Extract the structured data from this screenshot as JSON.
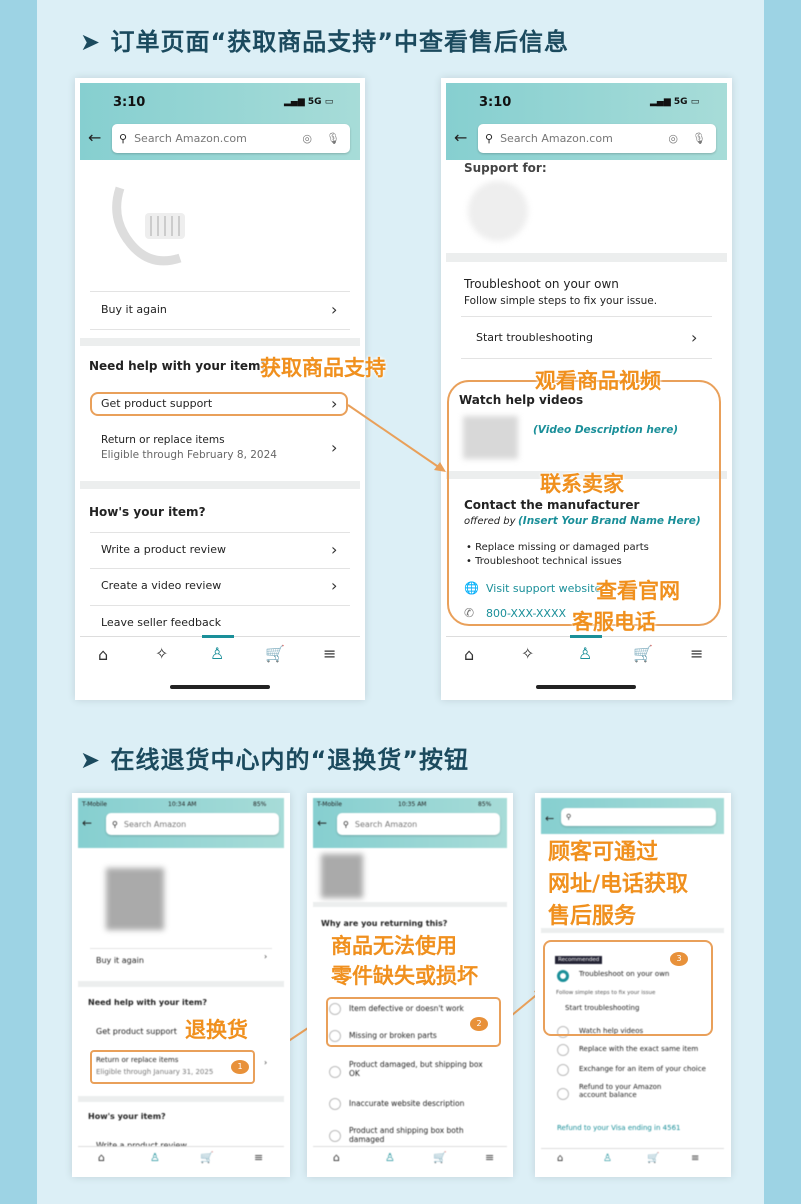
{
  "section1": {
    "title": "➤ 订单页面“获取商品支持”中查看售后信息"
  },
  "section2": {
    "title": "➤ 在线退货中心内的“退换货”按钮"
  },
  "phone_common": {
    "time": "3:10",
    "signal": "5G",
    "search_placeholder": "Search Amazon.com",
    "search_placeholder_short": "Search Amazon"
  },
  "phone1": {
    "buy_again": "Buy it again",
    "need_help": "Need help with your item?",
    "get_support": "Get product support",
    "return_replace": "Return or replace items",
    "eligible": "Eligible through February 8, 2024",
    "hows_item": "How's your item?",
    "write_review": "Write a product review",
    "create_video": "Create a video review",
    "seller_feedback": "Leave seller feedback"
  },
  "phone2": {
    "support_for": "Support for:",
    "troubleshoot_title": "Troubleshoot on your own",
    "troubleshoot_sub": "Follow simple steps to fix your issue.",
    "start_troubleshooting": "Start troubleshooting",
    "watch_videos": "Watch help videos",
    "video_desc": "(Video Description here)",
    "contact_title": "Contact the manufacturer",
    "offered_by": "offered by",
    "brand": "(Insert Your Brand Name Here)",
    "bullets": [
      "Replace missing or damaged parts",
      "Troubleshoot technical issues"
    ],
    "visit_site": "Visit support website",
    "phone": "800-XXX-XXXX"
  },
  "annotations": {
    "get_support": "获取商品支持",
    "watch_video": "观看商品视频",
    "contact_seller": "联系卖家",
    "official_site": "查看官网",
    "service_phone": "客服电话",
    "return_exchange": "退换货",
    "unusable": "商品无法使用",
    "missing_parts": "零件缺失或损坏",
    "customer_line1": "顾客可通过",
    "customer_line2": "网址/电话获取",
    "customer_line3": "售后服务"
  },
  "phone3": {
    "carrier": "T-Mobile",
    "time": "10:34 AM",
    "battery": "85%",
    "buy_again": "Buy it again",
    "need_help": "Need help with your item?",
    "get_support": "Get product support",
    "return_replace": "Return or replace items",
    "eligible": "Eligible through January 31, 2025",
    "hows_item": "How's your item?",
    "write_review": "Write a product review",
    "badge": "1"
  },
  "phone4": {
    "carrier": "T-Mobile",
    "time": "10:35 AM",
    "battery": "85%",
    "question": "Why are you returning this?",
    "options": [
      "Item defective or doesn't work",
      "Missing or broken parts",
      "Product damaged, but shipping box OK",
      "Inaccurate website description",
      "Product and shipping box both damaged"
    ],
    "badge": "2"
  },
  "phone5": {
    "recommended": "Recommended",
    "troubleshoot": "Troubleshoot on your own",
    "follow": "Follow simple steps to fix your issue",
    "start": "Start troubleshooting",
    "watch": "Watch help videos",
    "options": [
      "Replace with the exact same item",
      "Exchange for an item of your choice",
      "Refund to your Amazon account balance"
    ],
    "refund_card": "Refund to your Visa ending in 4561",
    "badge": "3"
  },
  "colors": {
    "accent": "#f0901e",
    "header": "#86cfd0",
    "title": "#1b4a5e",
    "link": "#1a8f99"
  }
}
